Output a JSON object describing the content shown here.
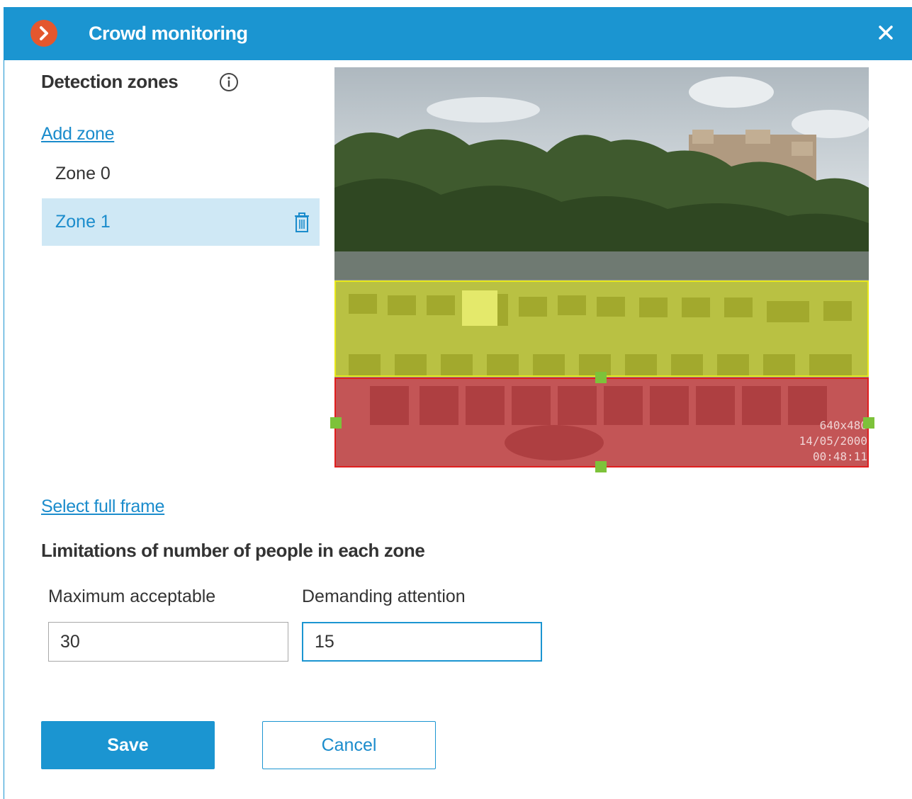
{
  "window": {
    "title": "Crowd monitoring",
    "brand_color": "#1b95d1",
    "logo_icon": "chevron-right-icon",
    "close_icon": "close-icon"
  },
  "detection": {
    "title": "Detection zones",
    "info_icon": "info-icon",
    "add_zone_label": "Add zone",
    "zones": [
      {
        "label": "Zone 0",
        "selected": false
      },
      {
        "label": "Zone 1",
        "selected": true
      }
    ],
    "select_full_frame_label": "Select full frame"
  },
  "preview": {
    "overlay_resolution": "640x480",
    "overlay_date": "14/05/2000",
    "overlay_time": "00:48:11",
    "zone_colors": {
      "zone_0": "#e8e81a",
      "zone_1": "#e01e1e"
    }
  },
  "limits": {
    "title": "Limitations of number of people in each zone",
    "max_label": "Maximum acceptable",
    "max_value": "30",
    "attention_label": "Demanding attention",
    "attention_value": "15"
  },
  "actions": {
    "save_label": "Save",
    "cancel_label": "Cancel"
  }
}
